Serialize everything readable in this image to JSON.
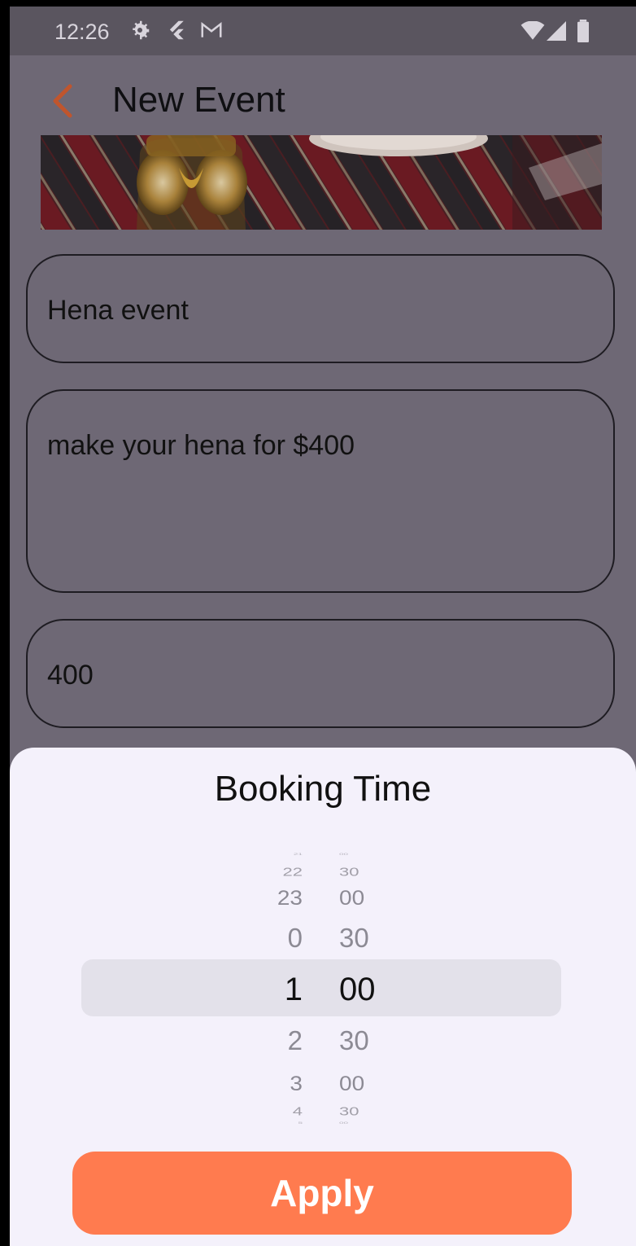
{
  "status_bar": {
    "time": "12:26",
    "icons": [
      "settings-icon",
      "flutter-icon",
      "gmail-icon",
      "wifi-icon",
      "signal-icon",
      "battery-icon"
    ]
  },
  "app_bar": {
    "back_icon": "chevron-left-icon",
    "title": "New Event",
    "accent_color": "#c0552d"
  },
  "form": {
    "name_value": "Hena event",
    "description_value": "make your hena for $400",
    "price_value": "400"
  },
  "time_picker": {
    "title": "Booking Time",
    "hours": [
      "21",
      "22",
      "23",
      "0",
      "1",
      "2",
      "3",
      "4",
      "5"
    ],
    "minutes": [
      "00",
      "30",
      "00",
      "30",
      "00",
      "30",
      "00",
      "30",
      "00"
    ],
    "selected_hour": "1",
    "selected_minute": "00",
    "apply_label": "Apply",
    "apply_color": "#ff7b4f"
  }
}
